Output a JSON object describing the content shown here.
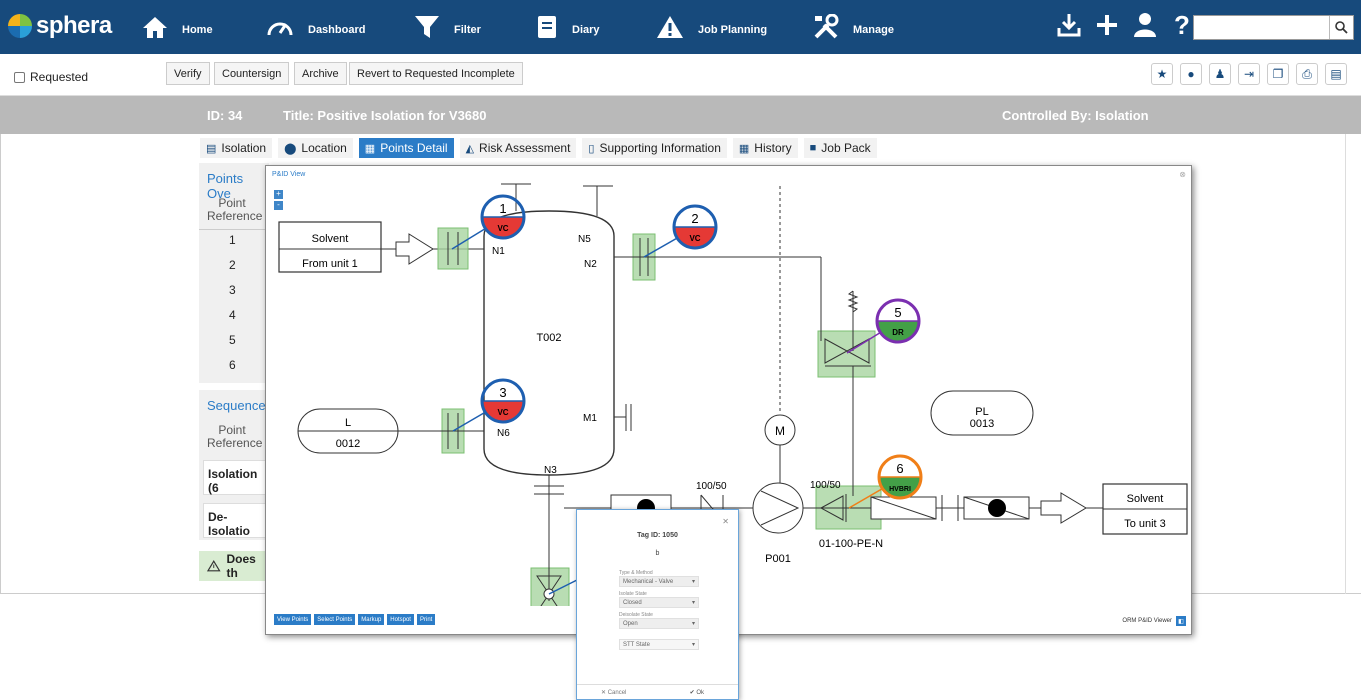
{
  "header": {
    "logo": "sphera",
    "nav": [
      {
        "label": "Home",
        "icon": "home-icon"
      },
      {
        "label": "Dashboard",
        "icon": "dashboard-icon"
      },
      {
        "label": "Filter",
        "icon": "filter-icon"
      },
      {
        "label": "Diary",
        "icon": "diary-icon"
      },
      {
        "label": "Job Planning",
        "icon": "warning-icon"
      },
      {
        "label": "Manage",
        "icon": "tools-icon"
      }
    ],
    "search_placeholder": ""
  },
  "toolbar": {
    "status": "Requested",
    "buttons": [
      "Verify",
      "Countersign",
      "Archive",
      "Revert to Requested Incomplete"
    ]
  },
  "record": {
    "id": "ID: 34",
    "title": "Title: Positive Isolation for V3680",
    "controlled_by": "Controlled By: Isolation"
  },
  "tabs": [
    {
      "label": "Isolation",
      "icon": "isolation-icon",
      "active": false
    },
    {
      "label": "Location",
      "icon": "location-pin-icon",
      "active": false
    },
    {
      "label": "Points Detail",
      "icon": "grid-icon",
      "active": true
    },
    {
      "label": "Risk Assessment",
      "icon": "risk-icon",
      "active": false
    },
    {
      "label": "Supporting Information",
      "icon": "document-icon",
      "active": false
    },
    {
      "label": "History",
      "icon": "calendar-icon",
      "active": false
    },
    {
      "label": "Job Pack",
      "icon": "folder-icon",
      "active": false
    }
  ],
  "points_panel": {
    "title": "Points Ove",
    "header": "Point Reference",
    "rows": [
      "1",
      "2",
      "3",
      "4",
      "5",
      "6"
    ]
  },
  "sequence_panel": {
    "title": "Sequence",
    "header": "Point Reference",
    "rows": [
      "Isolation (6",
      "De-Isolatio"
    ]
  },
  "warning": "Does th",
  "pid_view": {
    "title": "P&ID View",
    "zoom_in": "+",
    "zoom_out": "-",
    "tools": [
      "View Points",
      "Select Points",
      "Markup",
      "Hotspot",
      "Print"
    ],
    "footer": "ORM P&ID Viewer",
    "labels": {
      "solvent_in": "Solvent",
      "from_unit": "From unit 1",
      "tank": "T002",
      "l": "L",
      "l_num": "0012",
      "pl": "PL",
      "pl_num": "0013",
      "n1": "N1",
      "n2": "N2",
      "n3": "N3",
      "n5": "N5",
      "n6": "N6",
      "m1": "M1",
      "size1": "100/50",
      "size2": "100/50",
      "pump": "P001",
      "line": "01-100-PE-N",
      "solvent_out": "Solvent",
      "to_unit": "To unit 3",
      "motor": "M"
    },
    "points": [
      {
        "num": "1",
        "code": "VC",
        "color": "#e53935",
        "ring": "#1e5fb0"
      },
      {
        "num": "2",
        "code": "VC",
        "color": "#e53935",
        "ring": "#1e5fb0"
      },
      {
        "num": "3",
        "code": "VC",
        "color": "#e53935",
        "ring": "#1e5fb0"
      },
      {
        "num": "5",
        "code": "DR",
        "color": "#43a047",
        "ring": "#7b2fb0"
      },
      {
        "num": "6",
        "code": "HVBRI",
        "color": "#43a047",
        "ring": "#f07f18"
      }
    ]
  },
  "tag_dialog": {
    "title": "Tag ID: 1050",
    "subtitle": "b",
    "fields": [
      {
        "label": "Type & Method",
        "value": "Mechanical - Valve"
      },
      {
        "label": "Isolate State",
        "value": "Closed"
      },
      {
        "label": "Deisolate State",
        "value": "Open"
      },
      {
        "label": "",
        "value": "STT State"
      }
    ],
    "cancel": "Cancel",
    "ok": "Ok"
  }
}
